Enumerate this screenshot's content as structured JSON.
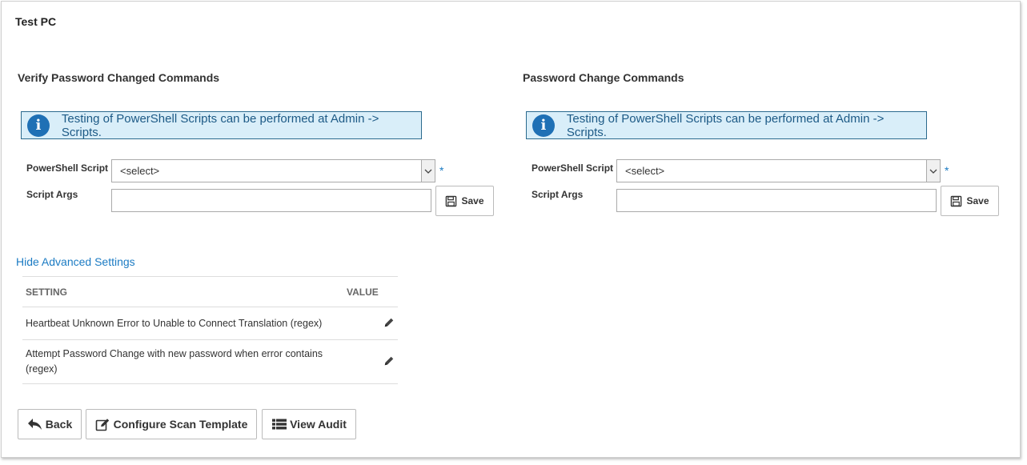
{
  "page": {
    "title": "Test PC"
  },
  "verify": {
    "title": "Verify Password Changed Commands",
    "info_text": "Testing of PowerShell Scripts can be performed at Admin -> Scripts.",
    "script_label": "PowerShell Script",
    "script_value": "<select>",
    "required_mark": "*",
    "args_label": "Script Args",
    "args_value": "",
    "save_label": "Save"
  },
  "change": {
    "title": "Password Change Commands",
    "info_text": "Testing of PowerShell Scripts can be performed at Admin -> Scripts.",
    "script_label": "PowerShell Script",
    "script_value": "<select>",
    "required_mark": "*",
    "args_label": "Script Args",
    "args_value": "",
    "save_label": "Save"
  },
  "advanced": {
    "toggle_label": "Hide Advanced Settings",
    "columns": [
      "SETTING",
      "VALUE"
    ],
    "rows": [
      {
        "setting": "Heartbeat Unknown Error to Unable to Connect Translation (regex)",
        "value": ""
      },
      {
        "setting": "Attempt Password Change with new password when error contains (regex)",
        "value": ""
      }
    ]
  },
  "actions": {
    "back_label": "Back",
    "configure_label": "Configure Scan Template",
    "audit_label": "View Audit"
  },
  "icons": {
    "info": "info-icon",
    "dropdown": "chevron-down-icon",
    "save": "floppy-disk-icon",
    "edit": "pencil-icon",
    "back": "reply-arrow-icon",
    "configure": "edit-square-icon",
    "audit": "list-icon"
  },
  "colors": {
    "link": "#1b7bc3",
    "info_bg": "#d9eef9",
    "info_border": "#2b6a8e",
    "info_icon": "#1f70b5"
  }
}
